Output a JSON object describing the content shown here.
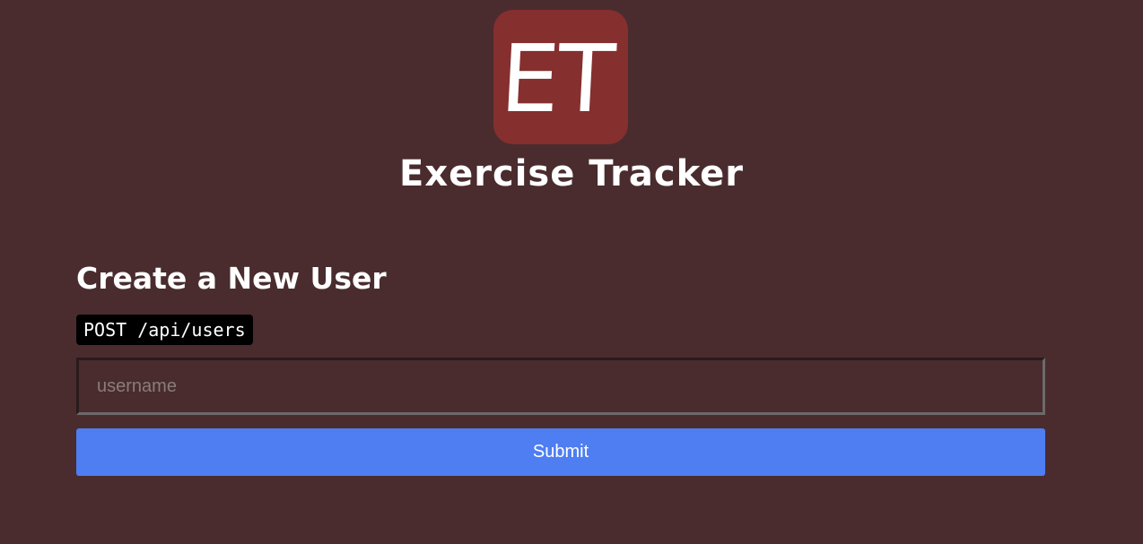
{
  "header": {
    "logo_text": "ET",
    "title": "Exercise Tracker"
  },
  "create_user": {
    "heading": "Create a New User",
    "endpoint": "POST /api/users",
    "username_placeholder": "username",
    "username_value": "",
    "submit_label": "Submit"
  },
  "colors": {
    "background": "#4a2c2e",
    "logo_background": "#852f2f",
    "button_accent": "#4e7ef1",
    "code_background": "#000000"
  }
}
